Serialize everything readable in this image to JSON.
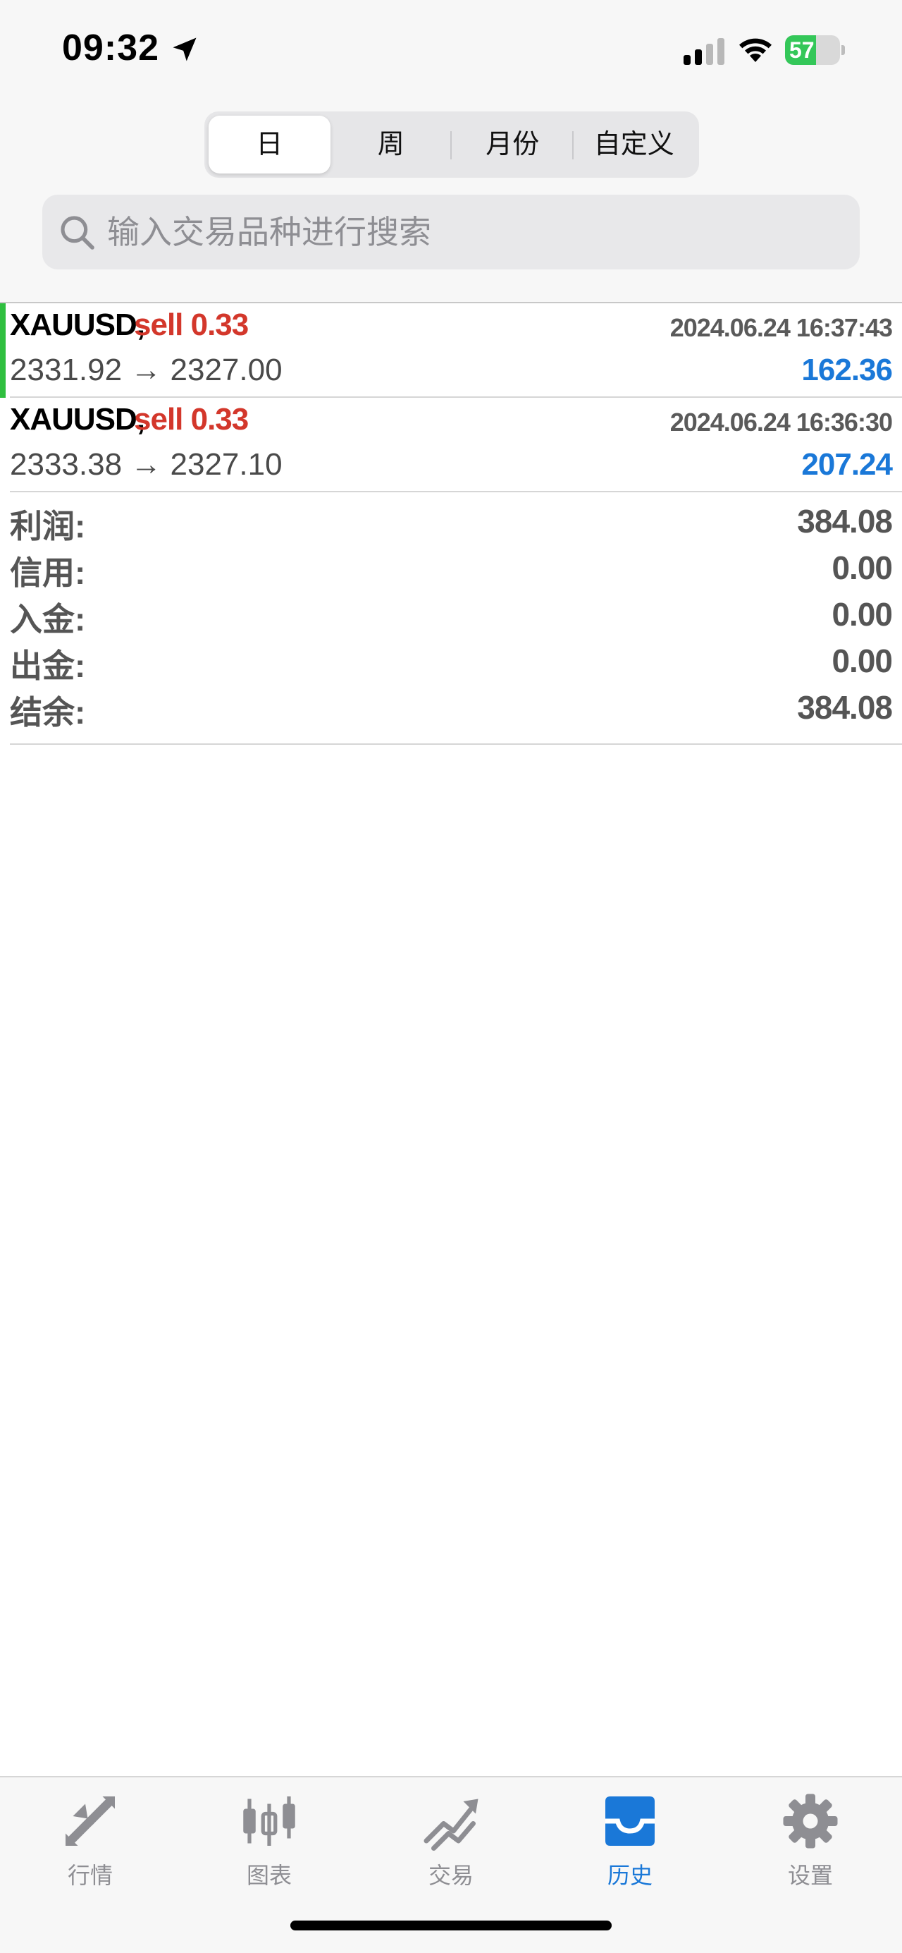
{
  "status_bar": {
    "time": "09:32",
    "battery": "57",
    "battery_level": 0.57,
    "icons": [
      "location-arrow-icon",
      "cellular-signal-icon",
      "wifi-icon",
      "battery-charging-icon"
    ]
  },
  "period_tabs": [
    {
      "label": "日",
      "active": true
    },
    {
      "label": "周",
      "active": false
    },
    {
      "label": "月份",
      "active": false
    },
    {
      "label": "自定义",
      "active": false
    }
  ],
  "search": {
    "placeholder": "输入交易品种进行搜索",
    "value": ""
  },
  "deals": [
    {
      "symbol": "XAUUSD,",
      "type": "sell 0.33",
      "time": "2024.06.24 16:37:43",
      "prices": "2331.92 → 2327.00",
      "profit": "162.36",
      "selected": true
    },
    {
      "symbol": "XAUUSD,",
      "type": "sell 0.33",
      "time": "2024.06.24 16:36:30",
      "prices": "2333.38 → 2327.10",
      "profit": "207.24",
      "selected": false
    }
  ],
  "summary": [
    {
      "label": "利润:",
      "value": "384.08"
    },
    {
      "label": "信用:",
      "value": "0.00"
    },
    {
      "label": "入金:",
      "value": "0.00"
    },
    {
      "label": "出金:",
      "value": "0.00"
    },
    {
      "label": "结余:",
      "value": "384.08"
    }
  ],
  "tab_bar": [
    {
      "label": "行情",
      "icon": "quotes-arrows-icon",
      "active": false
    },
    {
      "label": "图表",
      "icon": "candlestick-chart-icon",
      "active": false
    },
    {
      "label": "交易",
      "icon": "trade-trend-icon",
      "active": false
    },
    {
      "label": "历史",
      "icon": "history-inbox-icon",
      "active": true
    },
    {
      "label": "设置",
      "icon": "settings-gear-icon",
      "active": false
    }
  ],
  "colors": {
    "accent": "#1a78d8",
    "sell": "#d3372b",
    "selected_bar": "#2fbf3f",
    "battery": "#34c759"
  }
}
